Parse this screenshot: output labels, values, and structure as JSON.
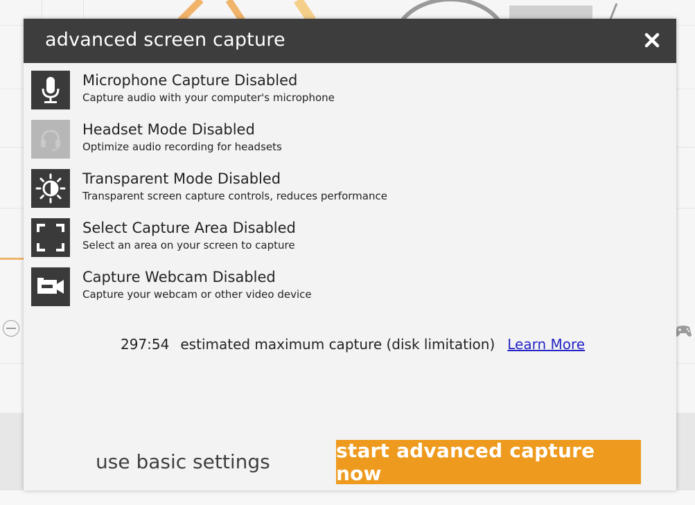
{
  "dialog": {
    "title": "advanced screen capture",
    "close_icon": "close-icon"
  },
  "options": [
    {
      "title": "Microphone Capture Disabled",
      "desc": "Capture audio with your computer's microphone",
      "icon": "microphone-icon",
      "enabled": true
    },
    {
      "title": "Headset Mode Disabled",
      "desc": "Optimize audio recording for headsets",
      "icon": "headset-icon",
      "enabled": false
    },
    {
      "title": "Transparent Mode Disabled",
      "desc": "Transparent screen capture controls, reduces performance",
      "icon": "brightness-icon",
      "enabled": true
    },
    {
      "title": "Select Capture Area Disabled",
      "desc": "Select an area on your screen to capture",
      "icon": "select-area-icon",
      "enabled": true
    },
    {
      "title": "Capture Webcam Disabled",
      "desc": "Capture your webcam or other video device",
      "icon": "webcam-icon",
      "enabled": true
    }
  ],
  "estimate": {
    "time": "297:54",
    "text": "estimated maximum capture (disk limitation)",
    "link": "Learn More"
  },
  "buttons": {
    "basic": "use basic settings",
    "start": "start advanced capture now"
  },
  "colors": {
    "titlebar": "#3d3d3d",
    "accent": "#ee9a1e",
    "link": "#2424c8",
    "icon_bg": "#3a3a3a",
    "icon_disabled_bg": "#b7b7b7"
  }
}
